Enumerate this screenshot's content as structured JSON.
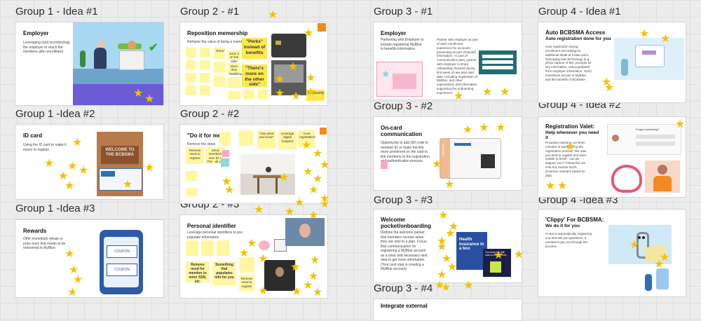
{
  "group_labels": {
    "g1_idea1": "Group 1 - Idea #1",
    "g1_idea2": "Group 1 -Idea #2",
    "g1_idea3": "Group 1 -Idea #3",
    "g2_1": "Group 2 - #1",
    "g2_2": "Group 2 - #2",
    "g2_3": "Group 2 - #3",
    "g3_1": "Group 3 - #1",
    "g3_2": "Group 3 - #2",
    "g3_3": "Group 3 - #3",
    "g3_4": "Group 3 - #4",
    "g4_idea1": "Group 4 - Idea #1",
    "g4_idea2": "Group 4 - Idea #2",
    "g4_idea3": "Group 4 -Idea #3"
  },
  "frames": {
    "g1a": {
      "title": "Employer",
      "body": "Leveraging (and incentivizing) the employer to reach the members after enrollment"
    },
    "g1b": {
      "title": "ID card",
      "body": "Using the ID card to make it easier to register",
      "box_text": "WELCOME TO THE BCBSMA"
    },
    "g1c": {
      "title": "Rewards",
      "body": "Offer immediate rebate or prize once that needs to be redeemed in MyBlue",
      "coupon": "COUPON"
    },
    "g2a": {
      "title": "Reposition memership",
      "body": "Reframe the value of being a member",
      "notes": [
        "\"Extra\"",
        "\"Perks\" instead of benefits",
        "\"There's more on the other side\"",
        "More than healthcare",
        "Save it on the table",
        "Exclusivity"
      ]
    },
    "g2b": {
      "title": "\"Do it for me!\"",
      "body": "Remove the steps",
      "notes": [
        "Remove need to register",
        "Send members user ID + PW - all set",
        "\"Use what you know\"",
        "Leverage digital footprint",
        "\"Auto registration\""
      ]
    },
    "g2c": {
      "title": "Personal identifier",
      "body": "Leverage personal identifiers to pre-populate information",
      "notes": [
        "Remove need for member to enter SSN, etc.",
        "Something that populates info for you",
        "Remove need to register"
      ]
    },
    "g3a": {
      "title": "Employer",
      "body": "Partnering with Employer to include registering MyBlue in benefits information.",
      "body2": "Partner with employer as part of open enrollment experience for accounts, presenting as part of benefit information. As part of communication plan, partner with employer to share onboarding checklist during first week of new plan start date. Including registration of MyBlue, and other expectations and information supporting the onboarding experience."
    },
    "g3b": {
      "title": "On-card communication",
      "body": "Opportunity to add QR code to member ID or make the link more prominent on the card to link members to the registration and authentication process.",
      "card_label": "MEMBER"
    },
    "g3c": {
      "title": "Welcome pocket/onboarding",
      "body": "Rethink the welcome packet that members receive when they are new to a plan. Focus that communication on registering a MyBlue account as a clear and necessary next step to get more information. (Your next step is creating a MyBlue account)",
      "book_text": "Health insurance in a box",
      "book2_text": "You know the drill: scan to before entry"
    },
    "g3d": {
      "title": "Integrate external"
    },
    "g4a": {
      "title": "Auto BCBSMA Access",
      "subtitle": "Auto registration done for you",
      "body": "Auto registration during enrollment and asking for additional detail at a later point leveraging new technology (e.g., photo capture of IDs, prompts for key information, auto-populated from employer information, SSO) Incentivize access to MyBlue and the benefits of BCBSMA"
    },
    "g4b": {
      "title": "Registration Valet:",
      "subtitle": "Help whenever you need it",
      "body": "Proactive reaching out when member is stuck during the registration process \"We saw you tried to register and were unable to finish - can we support you?\" Interaction via chat bot, human touch, proactive outreach based on data",
      "panel_text": "Forgot something?"
    },
    "g4c": {
      "title": "'Clippy' For BCBSMA:",
      "subtitle": "We do it for you",
      "body": "AI Bot is automatically registering you and ask you questions, if needed to get you through the process"
    }
  },
  "colors": {
    "star": "#f2c200",
    "sticky": "#fff7a0",
    "sticky_strong": "#fde84f",
    "orange": "#f38a1f",
    "blue": "#2d6fb7",
    "pink": "#f7a8c7"
  }
}
